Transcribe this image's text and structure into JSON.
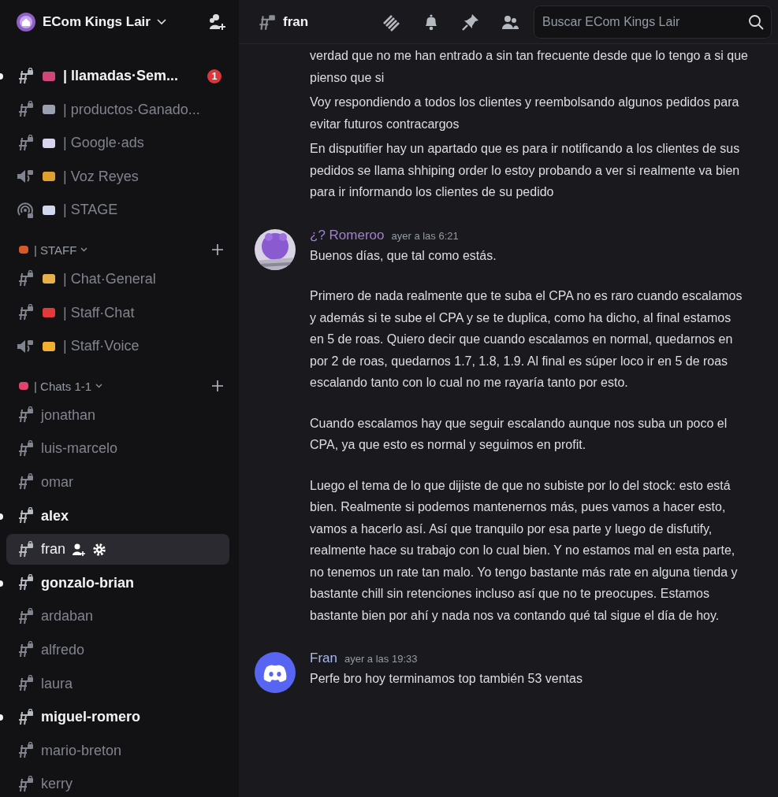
{
  "server": {
    "name": "ECom Kings Lair"
  },
  "channels": [
    {
      "kind": "text",
      "color": "#d1467a",
      "name": "| llamadas·Sem...",
      "unread": true,
      "badge": "1",
      "selected": false
    },
    {
      "kind": "text",
      "color": "#9aa0b0",
      "name": "| productos·Ganado...",
      "unread": false,
      "selected": false
    },
    {
      "kind": "text",
      "color": "#d8d4f0",
      "name": "| Google·ads",
      "unread": false,
      "selected": false
    },
    {
      "kind": "voice",
      "color": "#e0a030",
      "name": "| Voz Reyes",
      "unread": false,
      "selected": false
    },
    {
      "kind": "stage",
      "color": "#cfd8ec",
      "name": "| STAGE",
      "unread": false,
      "selected": false
    },
    {
      "kind": "category",
      "color": "#d9582a",
      "name": "| STAFF"
    },
    {
      "kind": "text",
      "color": "#e6b04a",
      "name": "| Chat·General",
      "unread": false,
      "selected": false
    },
    {
      "kind": "text",
      "color": "#e03a3a",
      "name": "| Staff·Chat",
      "unread": false,
      "selected": false
    },
    {
      "kind": "voice",
      "color": "#f0b030",
      "name": "| Staff·Voice",
      "unread": false,
      "selected": false
    },
    {
      "kind": "category",
      "color": "#e0446c",
      "name": "| Chats 1-1"
    },
    {
      "kind": "text",
      "name": "jonathan",
      "unread": false,
      "selected": false
    },
    {
      "kind": "text",
      "name": "luis-marcelo",
      "unread": false,
      "selected": false
    },
    {
      "kind": "text",
      "name": "omar",
      "unread": false,
      "selected": false
    },
    {
      "kind": "text",
      "name": "alex",
      "unread": true,
      "selected": false
    },
    {
      "kind": "text",
      "name": "fran",
      "unread": false,
      "selected": true
    },
    {
      "kind": "text",
      "name": "gonzalo-brian",
      "unread": true,
      "selected": false
    },
    {
      "kind": "text",
      "name": "ardaban",
      "unread": false,
      "selected": false
    },
    {
      "kind": "text",
      "name": "alfredo",
      "unread": false,
      "selected": false
    },
    {
      "kind": "text",
      "name": "laura",
      "unread": false,
      "selected": false
    },
    {
      "kind": "text",
      "name": "miguel-romero",
      "unread": true,
      "selected": false
    },
    {
      "kind": "text",
      "name": "mario-breton",
      "unread": false,
      "selected": false
    },
    {
      "kind": "text",
      "name": "kerry",
      "unread": false,
      "selected": false
    }
  ],
  "header": {
    "channel": "fran",
    "search": {
      "placeholder": "Buscar ECom Kings Lair"
    }
  },
  "messages": [
    {
      "kind": "continuation",
      "paragraphs": [
        "verdad que no me han entrado a sin tan frecuente desde que lo tengo a si que pienso que si",
        "Voy respondiendo a todos los clientes y reembolsando algunos pedidos para evitar futuros contracargos",
        "En disputifier hay un apartado que es para ir notificando a los clientes de sus pedidos se llama shhiping order lo estoy probando a ver si realmente va bien para ir informando los clientes de su pedido"
      ]
    },
    {
      "kind": "message",
      "author": "¿? Romeroo",
      "color": "#a27fd0",
      "time": "ayer a las 6:21",
      "paragraphs": [
        "Buenos días, que tal como estás.",
        "Primero de nada realmente que te suba el CPA no es raro cuando escalamos y además si te sube el CPA y se te duplica, como ha dicho, al final estamos en 5 de roas. Quiero decir que cuando escalamos en normal, quedarnos en por 2 de roas, quedarnos 1.7, 1.8, 1.9. Al final es súper loco ir en 5 de roas escalando tanto con lo cual no me rayaría tanto por esto.",
        "Cuando escalamos hay que seguir escalando aunque nos suba un poco el CPA, ya que esto es normal y seguimos en profit.",
        "Luego el tema de lo que dijiste de que no subiste por lo del stock: esto está bien. Realmente si podemos mantenernos más, pues vamos a hacer esto, vamos a hacerlo así. Así que tranquilo por esa parte y luego de disfutify, realmente hace su trabajo con lo cual bien. Y no estamos mal en esta parte, no tenemos un rate tan malo. Yo tengo bastante más rate en alguna tienda y bastante chill sin retenciones incluso así que no te preocupes. Estamos bastante bien por ahí y nada nos va contando qué tal sigue el día de hoy."
      ]
    },
    {
      "kind": "message",
      "avatar": {
        "kind": "logo"
      },
      "author": "Fran",
      "color": "#a9b8f0",
      "time": "ayer a las 19:33",
      "paragraphs": [
        "Perfe bro hoy terminamos top también 53 ventas"
      ]
    }
  ]
}
